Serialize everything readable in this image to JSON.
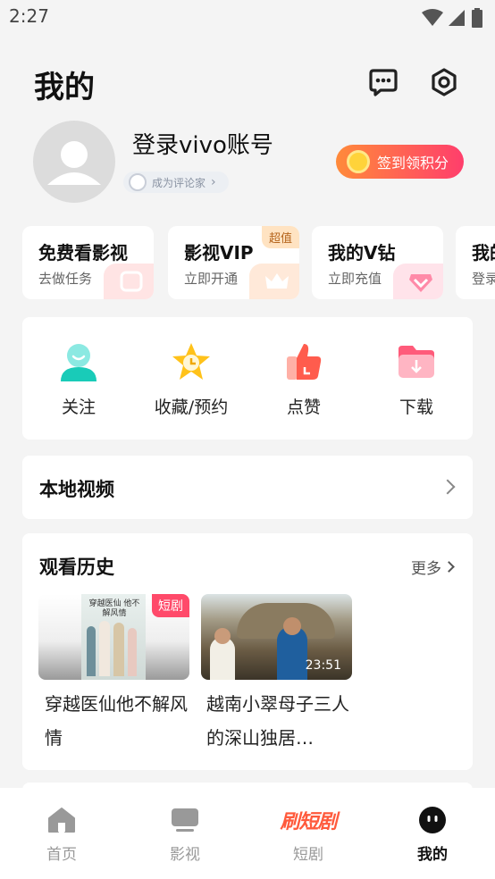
{
  "status": {
    "time": "2:27"
  },
  "header": {
    "title": "我的"
  },
  "profile": {
    "login_text": "登录vivo账号",
    "badge_text": "成为评论家",
    "signin_label": "签到领积分"
  },
  "quick_cards": [
    {
      "title": "免费看影视",
      "subtitle": "去做任务",
      "tag": ""
    },
    {
      "title": "影视VIP",
      "subtitle": "立即开通",
      "tag": "超值"
    },
    {
      "title": "我的V钻",
      "subtitle": "立即充值",
      "tag": ""
    },
    {
      "title": "我的",
      "subtitle": "登录",
      "tag": ""
    }
  ],
  "favorites": {
    "items": [
      {
        "label": "关注",
        "icon": "follow-icon"
      },
      {
        "label": "收藏/预约",
        "icon": "star-clock-icon"
      },
      {
        "label": "点赞",
        "icon": "thumb-up-icon"
      },
      {
        "label": "下载",
        "icon": "download-folder-icon"
      }
    ]
  },
  "local_video": {
    "title": "本地视频"
  },
  "history": {
    "title": "观看历史",
    "more_label": "更多",
    "items": [
      {
        "title": "穿越医仙他不解风情",
        "badge": "短剧",
        "duration": "",
        "poster_text": "穿越医仙 他不解风情"
      },
      {
        "title": "越南小翠母子三人的深山独居…",
        "badge": "",
        "duration": "23:51",
        "poster_text": ""
      }
    ]
  },
  "tabbar": {
    "tabs": [
      {
        "label": "首页",
        "icon": "home-icon",
        "active": false
      },
      {
        "label": "影视",
        "icon": "tv-icon",
        "active": false
      },
      {
        "label": "短剧",
        "icon": "shuaduanju-logo",
        "active": false,
        "logo_text": "刷短剧"
      },
      {
        "label": "我的",
        "icon": "mine-face-icon",
        "active": true
      }
    ]
  },
  "colors": {
    "accent_orange": "#ff8a3a",
    "accent_pink": "#ff3e6c",
    "badge_red": "#ff4a6a",
    "background": "#f4f4f4"
  }
}
